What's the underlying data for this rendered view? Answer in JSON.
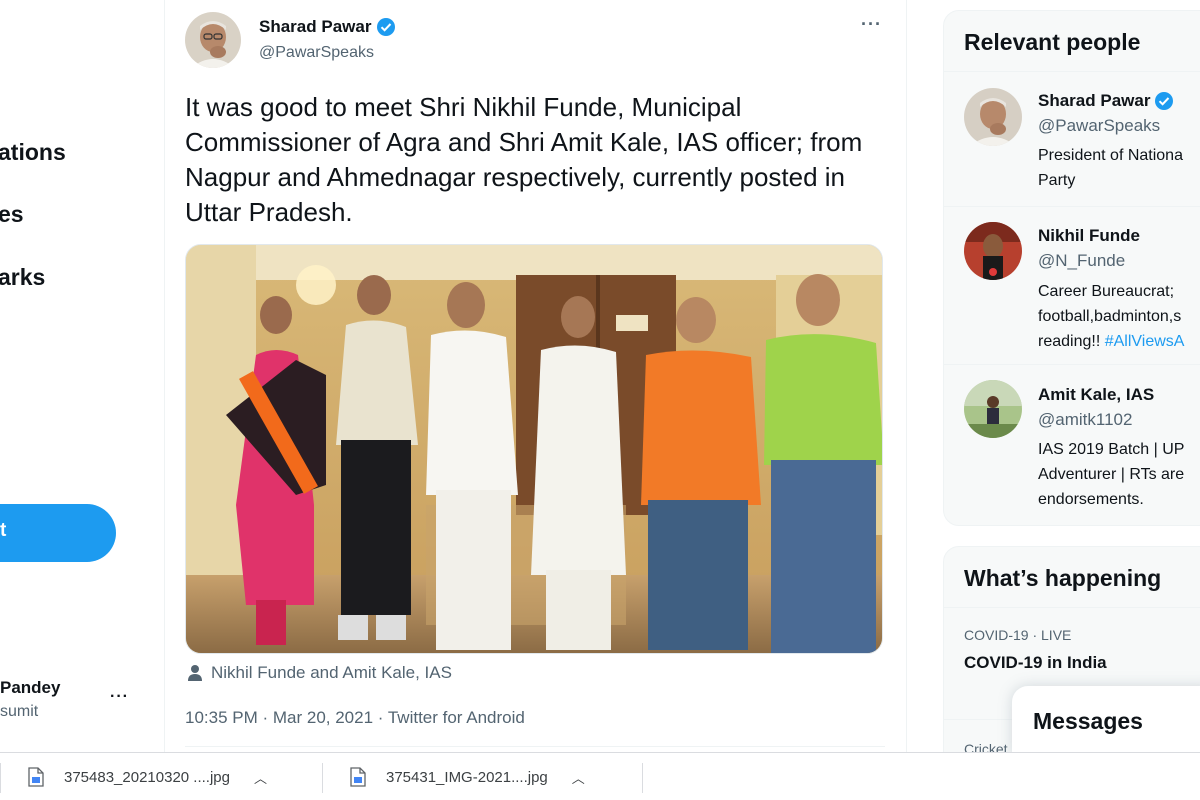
{
  "sidebar": {
    "items": [
      {
        "label": "ations"
      },
      {
        "label": "es"
      },
      {
        "label": "arks"
      }
    ],
    "tweet_button_label": "t",
    "account_name": "Pandey",
    "account_handle": "sumit",
    "more_label": "···"
  },
  "tweet": {
    "author_name": "Sharad Pawar",
    "author_handle": "@PawarSpeaks",
    "more_label": "···",
    "text": "It was good to meet Shri Nikhil Funde, Municipal Commissioner of Agra and Shri Amit Kale, IAS officer; from Nagpur and Ahmednagar respectively, currently posted in Uttar Pradesh.",
    "tagged": "Nikhil Funde and Amit Kale, IAS",
    "timestamp": "10:35 PM · Mar 20, 2021 · Twitter for Android"
  },
  "relevant_people": {
    "title": "Relevant people",
    "people": [
      {
        "name": "Sharad Pawar",
        "handle": "@PawarSpeaks",
        "verified": true,
        "bio_lines": [
          "President of Nationa",
          "Party"
        ],
        "hashtag": ""
      },
      {
        "name": "Nikhil Funde",
        "handle": "@N_Funde",
        "verified": false,
        "bio_lines": [
          "Career Bureaucrat;",
          "football,badminton,s",
          "reading!! "
        ],
        "hashtag": "#AllViewsA"
      },
      {
        "name": "Amit Kale, IAS",
        "handle": "@amitk1102",
        "verified": false,
        "bio_lines": [
          "IAS 2019 Batch | UP",
          "Adventurer | RTs are",
          "endorsements."
        ],
        "hashtag": ""
      }
    ]
  },
  "whats_happening": {
    "title": "What’s happening",
    "trends": [
      {
        "category": "COVID-19 · LIVE",
        "title": "COVID-19 in India"
      },
      {
        "category": "Cricket",
        "title": ""
      }
    ]
  },
  "messages": {
    "label": "Messages"
  },
  "downloads": [
    {
      "name": "375483_20210320 ....jpg"
    },
    {
      "name": "375431_IMG-2021....jpg"
    }
  ],
  "colors": {
    "accent": "#1d9bf0",
    "text": "#0f1419",
    "secondary": "#536471"
  }
}
